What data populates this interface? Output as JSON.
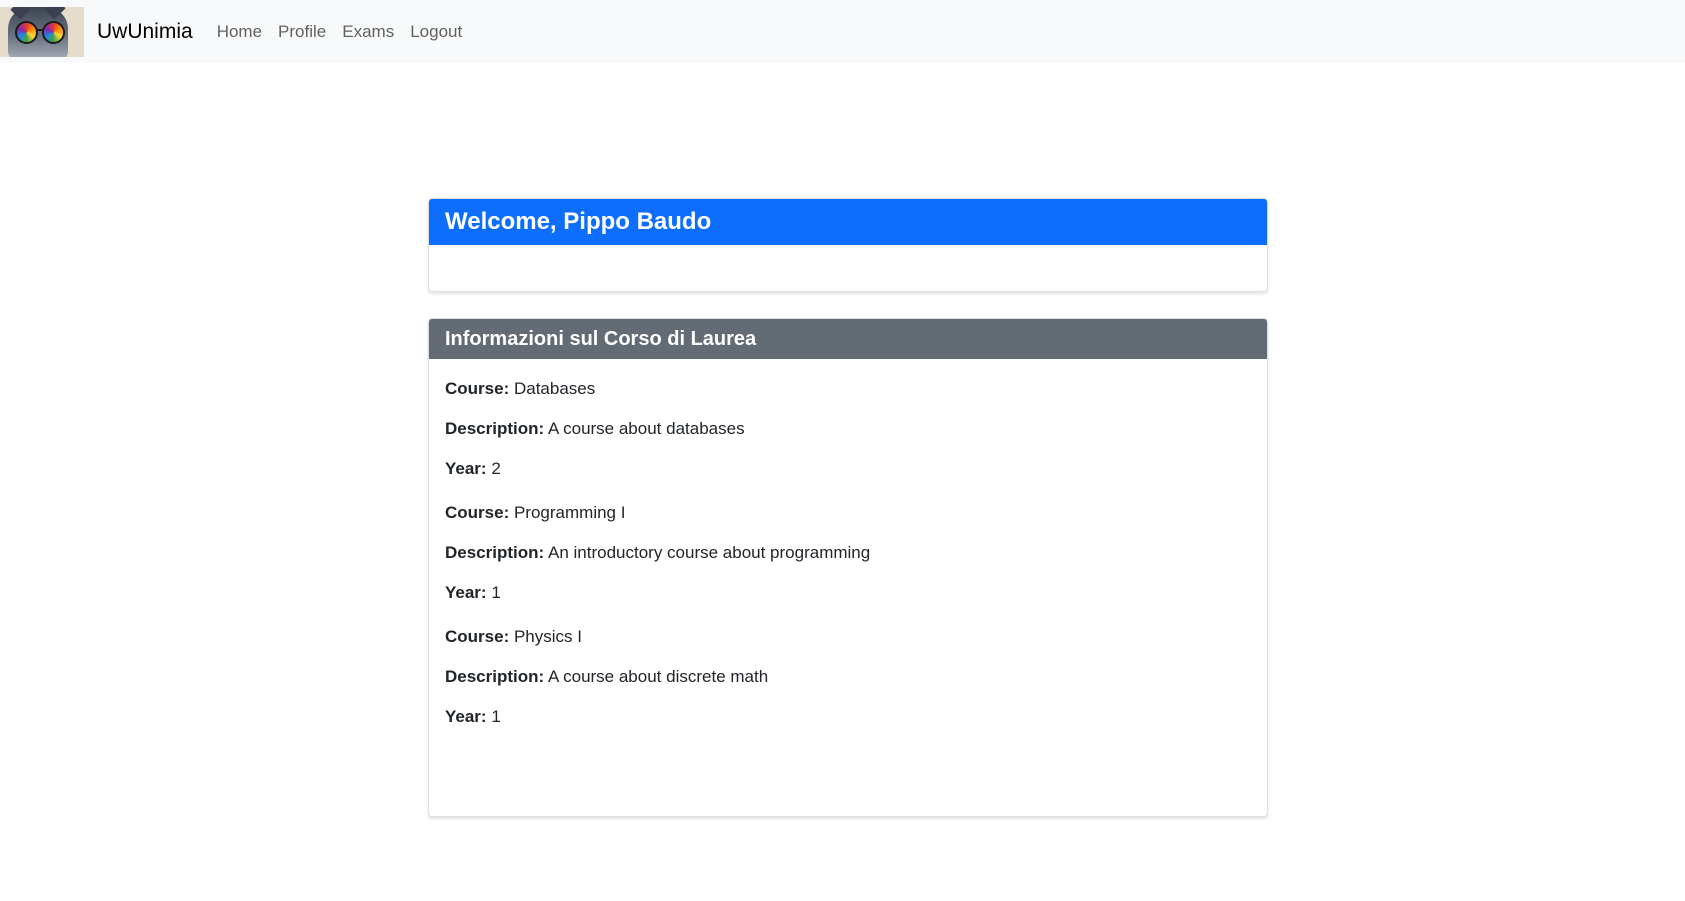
{
  "navbar": {
    "brand": "UwUnimia",
    "logo_icon": "cat-with-rainbow-sunglasses-logo",
    "links": [
      "Home",
      "Profile",
      "Exams",
      "Logout"
    ]
  },
  "welcome_card": {
    "title": "Welcome, Pippo Baudo",
    "header_color": "#0d6efd"
  },
  "info_card": {
    "title": "Informazioni sul Corso di Laurea",
    "header_color": "#636b74",
    "labels": {
      "course": "Course:",
      "description": "Description:",
      "year": "Year:"
    },
    "courses": [
      {
        "course": "Databases",
        "description": "A course about databases",
        "year": "2"
      },
      {
        "course": "Programming I",
        "description": "An introductory course about programming",
        "year": "1"
      },
      {
        "course": "Physics I",
        "description": "A course about discrete math",
        "year": "1"
      }
    ]
  }
}
